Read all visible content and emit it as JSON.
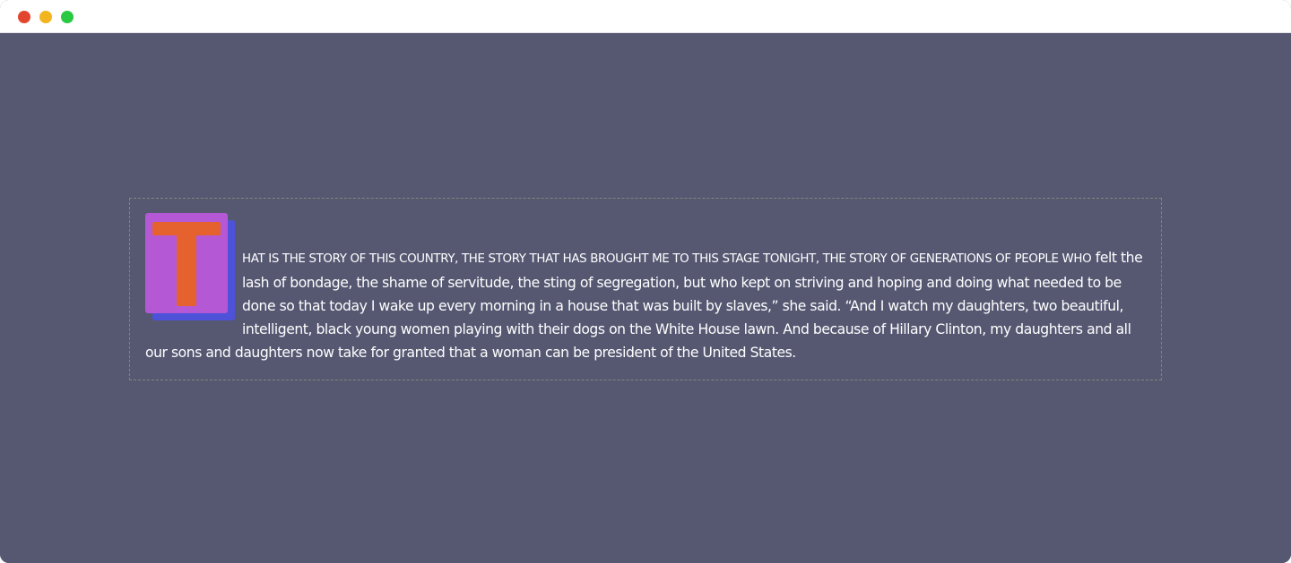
{
  "window": {
    "traffic_lights": {
      "close_color": "#e2462f",
      "minimize_color": "#f3b51f",
      "maximize_color": "#29c941"
    },
    "background_color": "#565872"
  },
  "quote": {
    "dropcap_letter": "T",
    "dropcap_colors": {
      "box": "#b458d6",
      "shadow": "#4d52d8",
      "letter": "#e5612d"
    },
    "lead_caps": "hat is the story of this country, the story that has brought me to this stage tonight, the story of generations of people who",
    "body": "felt the lash of bondage, the shame of servitude, the sting of segregation, but who kept on striving and hoping and doing what needed to be done so that today I wake up every morning in a house that was built by slaves,” she said. “And I watch my daughters, two beautiful, intelligent, black young women playing with their dogs on the White House lawn. And because of Hillary Clinton, my daughters and all our sons and daughters now take for granted that a woman can be president of the United States."
  }
}
